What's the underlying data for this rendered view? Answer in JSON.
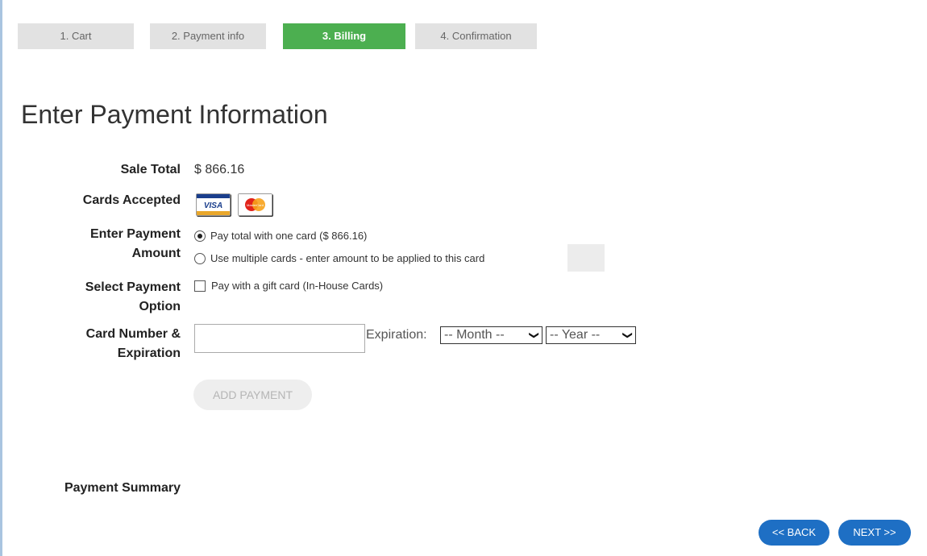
{
  "steps": [
    {
      "label": "1. Cart"
    },
    {
      "label": "2. Payment info"
    },
    {
      "label": "3. Billing"
    },
    {
      "label": "4. Confirmation"
    }
  ],
  "page_title": "Enter Payment Information",
  "sale_total": {
    "label": "Sale Total",
    "value": "$ 866.16"
  },
  "cards_accepted": {
    "label": "Cards Accepted",
    "cards": [
      "VISA",
      "MasterCard"
    ]
  },
  "payment_amount": {
    "label_line1": "Enter Payment",
    "label_line2": "Amount",
    "option_total": "Pay total with one card ($ 866.16)",
    "option_multiple": "Use multiple cards - enter amount to be applied to this card"
  },
  "payment_option": {
    "label_line1": "Select Payment",
    "label_line2": "Option",
    "gift_card": "Pay with a gift card (In-House Cards)"
  },
  "card_number": {
    "label_line1": "Card Number &",
    "label_line2": "Expiration",
    "expiration_label": "Expiration:",
    "month_selected": "-- Month --",
    "year_selected": "-- Year --"
  },
  "add_payment": "ADD PAYMENT",
  "payment_summary": "Payment Summary",
  "nav": {
    "back": "<< BACK",
    "next": "NEXT >>"
  },
  "colors": {
    "active_step": "#4caf50",
    "nav_button": "#1e6fc4",
    "step_bg": "#e2e2e2"
  }
}
